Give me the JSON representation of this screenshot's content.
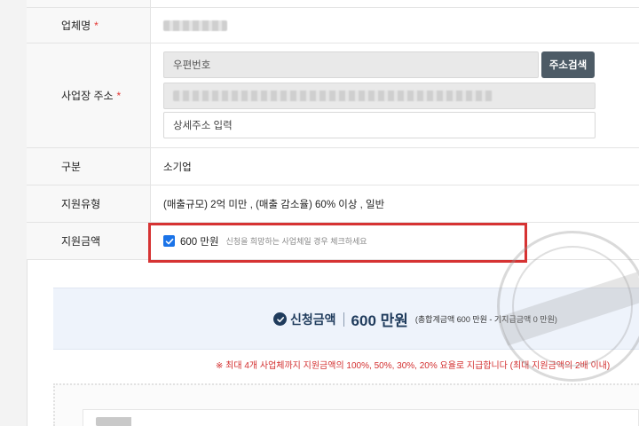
{
  "form": {
    "company": {
      "label": "업체명",
      "required_mark": "*"
    },
    "address": {
      "label": "사업장 주소",
      "required_mark": "*",
      "zipcode_placeholder": "우편번호",
      "search_button": "주소검색",
      "detail_placeholder": "상세주소 입력"
    },
    "category": {
      "label": "구분",
      "value": "소기업"
    },
    "support_type": {
      "label": "지원유형",
      "value": "(매출규모) 2억 미만 , (매출 감소율) 60% 이상 , 일반"
    },
    "support_amount": {
      "label": "지원금액",
      "checked": true,
      "amount": "600 만원",
      "hint": "신청을 희망하는 사업체일 경우 체크하세요"
    }
  },
  "summary": {
    "label": "신청금액",
    "amount": "600 만원",
    "detail": "(총합계금액 600 만원 - 기지급금액 0 만원)"
  },
  "notice": "※ 최대 4개 사업체까지 지원금액의 100%, 50%, 30%, 20% 요율로 지급합니다 (최대 지원금액의 2배 이내)",
  "colors": {
    "accent": "#1a73e8",
    "button": "#4d5b66",
    "highlight": "#d63333",
    "summary_text": "#1f3b5c",
    "notice": "#d32f2f"
  }
}
